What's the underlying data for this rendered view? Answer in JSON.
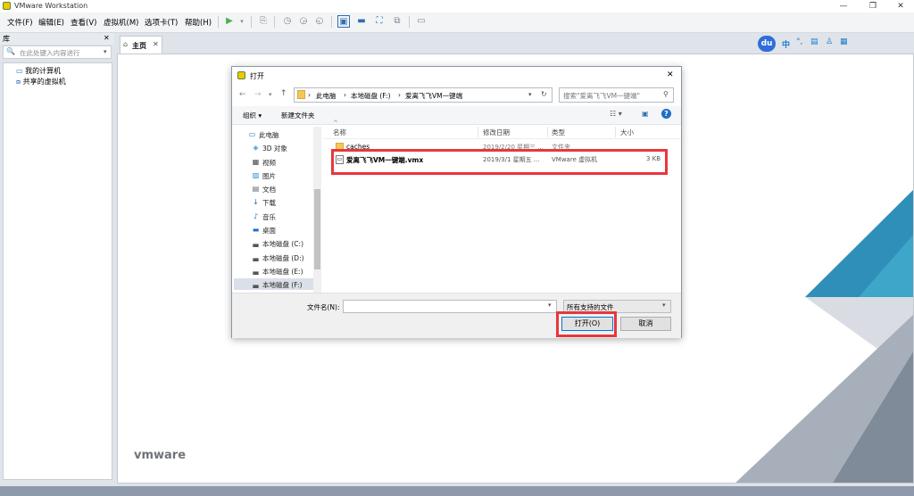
{
  "window": {
    "title": "VMware Workstation",
    "min": "—",
    "max": "❐",
    "close": "✕"
  },
  "menu": [
    "文件(F)",
    "编辑(E)",
    "查看(V)",
    "虚拟机(M)",
    "选项卡(T)",
    "帮助(H)"
  ],
  "library": {
    "title": "库",
    "close": "✕",
    "search_placeholder": "在此处键入内容进行",
    "items": [
      "我的计算机",
      "共享的虚拟机"
    ]
  },
  "tabs": {
    "home": "主页",
    "close": "✕"
  },
  "ime": {
    "logo": "du",
    "lang": "中"
  },
  "brand": "vmware",
  "dialog": {
    "title": "打开",
    "close": "✕",
    "path": [
      "此电脑",
      "本地磁盘 (F:)",
      "爱离飞飞VM一键端"
    ],
    "search_placeholder": "搜索\"爱离飞飞VM一键端\"",
    "organize": "组织 ▾",
    "new_folder": "新建文件夹",
    "columns": {
      "name": "名称",
      "date": "修改日期",
      "type": "类型",
      "size": "大小"
    },
    "files": [
      {
        "name": "caches",
        "date": "2019/2/20 星期三 ...",
        "type": "文件夹",
        "size": ""
      },
      {
        "name": "爱离飞飞VM一键端.vmx",
        "date": "2019/3/1 星期五 ...",
        "type": "VMware 虚拟机",
        "size": "3 KB"
      }
    ],
    "nav": [
      "此电脑",
      "3D 对象",
      "视频",
      "图片",
      "文档",
      "下载",
      "音乐",
      "桌面",
      "本地磁盘 (C:)",
      "本地磁盘 (D:)",
      "本地磁盘 (E:)",
      "本地磁盘 (F:)"
    ],
    "filename_label": "文件名(N):",
    "filetype": "所有支持的文件",
    "open": "打开(O)",
    "cancel": "取消"
  },
  "colors": {
    "highlight": "#e8373b",
    "accent": "#1a7fd0"
  }
}
